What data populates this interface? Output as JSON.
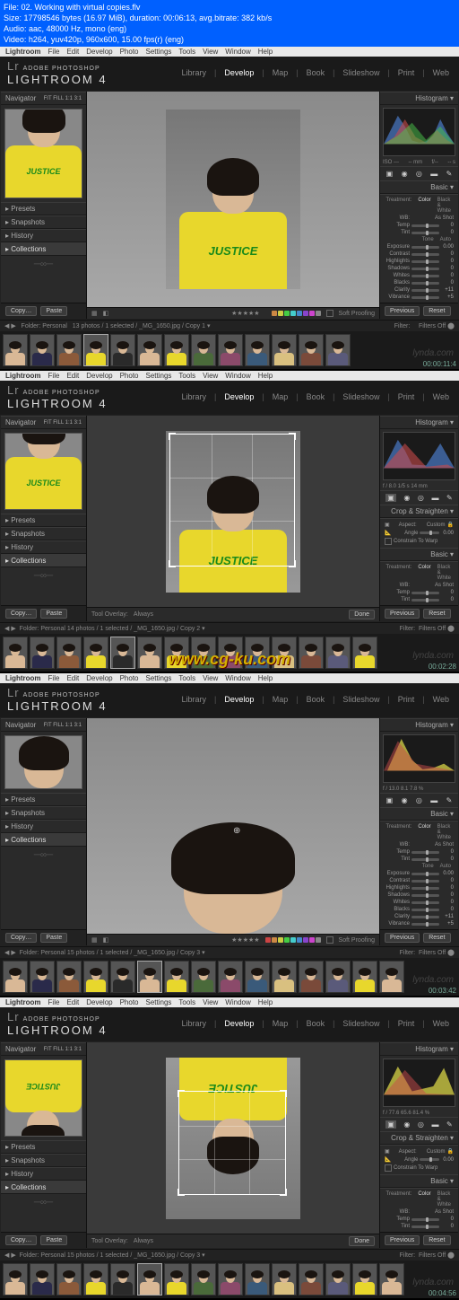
{
  "video_info": {
    "file": "File: 02. Working with virtual copies.flv",
    "size": "Size: 17798546 bytes (16.97 MiB), duration: 00:06:13, avg.bitrate: 382 kb/s",
    "audio": "Audio: aac, 48000 Hz, mono (eng)",
    "video": "Video: h264, yuv420p, 960x600, 15.00 fps(r) (eng)"
  },
  "mac_menu": [
    "Lightroom",
    "File",
    "Edit",
    "Develop",
    "Photo",
    "Settings",
    "Tools",
    "View",
    "Window",
    "Help"
  ],
  "branding": {
    "line1": "ADOBE PHOTOSHOP",
    "line2": "LIGHTROOM 4",
    "mark": "Lr"
  },
  "modules": [
    "Library",
    "Develop",
    "Map",
    "Book",
    "Slideshow",
    "Print",
    "Web"
  ],
  "left_panels": {
    "navigator": "Navigator",
    "nav_opts": "FIT   FILL   1:1   3:1",
    "presets": "▸ Presets",
    "snapshots": "▸ Snapshots",
    "history": "▸ History",
    "collections": "▸ Collections",
    "copy": "Copy…",
    "paste": "Paste"
  },
  "toolbar": {
    "tool_overlay": "Tool Overlay:",
    "always": "Always",
    "soft_proofing": "Soft Proofing",
    "done": "Done"
  },
  "right": {
    "histogram": "Histogram ▾",
    "basic": "Basic ▾",
    "crop": "Crop & Straighten ▾",
    "treatment": "Treatment:",
    "color": "Color",
    "bw": "Black & White",
    "wb_label": "WB:",
    "as_shot": "As Shot",
    "tone": "Tone",
    "auto": "Auto",
    "aspect": "Aspect:",
    "custom": "Custom",
    "lock": "🔒",
    "angle": "Angle",
    "angle_val": "0.00",
    "constrain": "Constrain To Warp",
    "previous": "Previous",
    "reset": "Reset",
    "sliders": [
      {
        "lbl": "Temp",
        "val": "0"
      },
      {
        "lbl": "Tint",
        "val": "0"
      },
      {
        "lbl": "Exposure",
        "val": "0.00"
      },
      {
        "lbl": "Contrast",
        "val": "0"
      },
      {
        "lbl": "Highlights",
        "val": "0"
      },
      {
        "lbl": "Shadows",
        "val": "0"
      },
      {
        "lbl": "Whites",
        "val": "0"
      },
      {
        "lbl": "Blacks",
        "val": "0"
      },
      {
        "lbl": "Clarity",
        "val": "+11"
      },
      {
        "lbl": "Vibrance",
        "val": "+5"
      }
    ],
    "histo_info_2": "f / 8.0     1/5 s     14 mm",
    "histo_info_3": "f / 13.0     8.1     7.8 %",
    "histo_info_4": "f / 77.6     65.6     81.4 %"
  },
  "filmstrip": {
    "folder": "Folder: Personal",
    "count1": "13 photos / 1 selected / _MG_1650.jpg / Copy 1 ▾",
    "count2": "14 photos / 1 selected / _MG_1650.jpg / Copy 2 ▾",
    "count3": "15 photos / 1 selected / _MG_1650.jpg / Copy 3 ▾",
    "filter": "Filter:",
    "filters_off": "Filters Off"
  },
  "timestamps": [
    "00:00:11:4",
    "00:02:28",
    "00:03:42",
    "00:04:56"
  ],
  "watermark": "www.cg-ku.com",
  "lynda": "lynda.com",
  "shirt_text": "JUSTICE",
  "colors": {
    "red": "#c44",
    "orange": "#c84",
    "yellow": "#cc4",
    "green": "#4c4",
    "cyan": "#4cc",
    "blue": "#48c",
    "purple": "#84c",
    "magenta": "#c4c",
    "gray": "#888"
  },
  "fs_shirts": [
    "#d9b896",
    "#2a2a4a",
    "#8b5a3a",
    "#e8d72c",
    "#2a2a2a",
    "#d9b896",
    "#e8d72c",
    "#4a6a3a",
    "#8b4a6a",
    "#3a5a7a",
    "#d9c080",
    "#7a4a3a",
    "#5a5a7a",
    "#e8d72c"
  ]
}
